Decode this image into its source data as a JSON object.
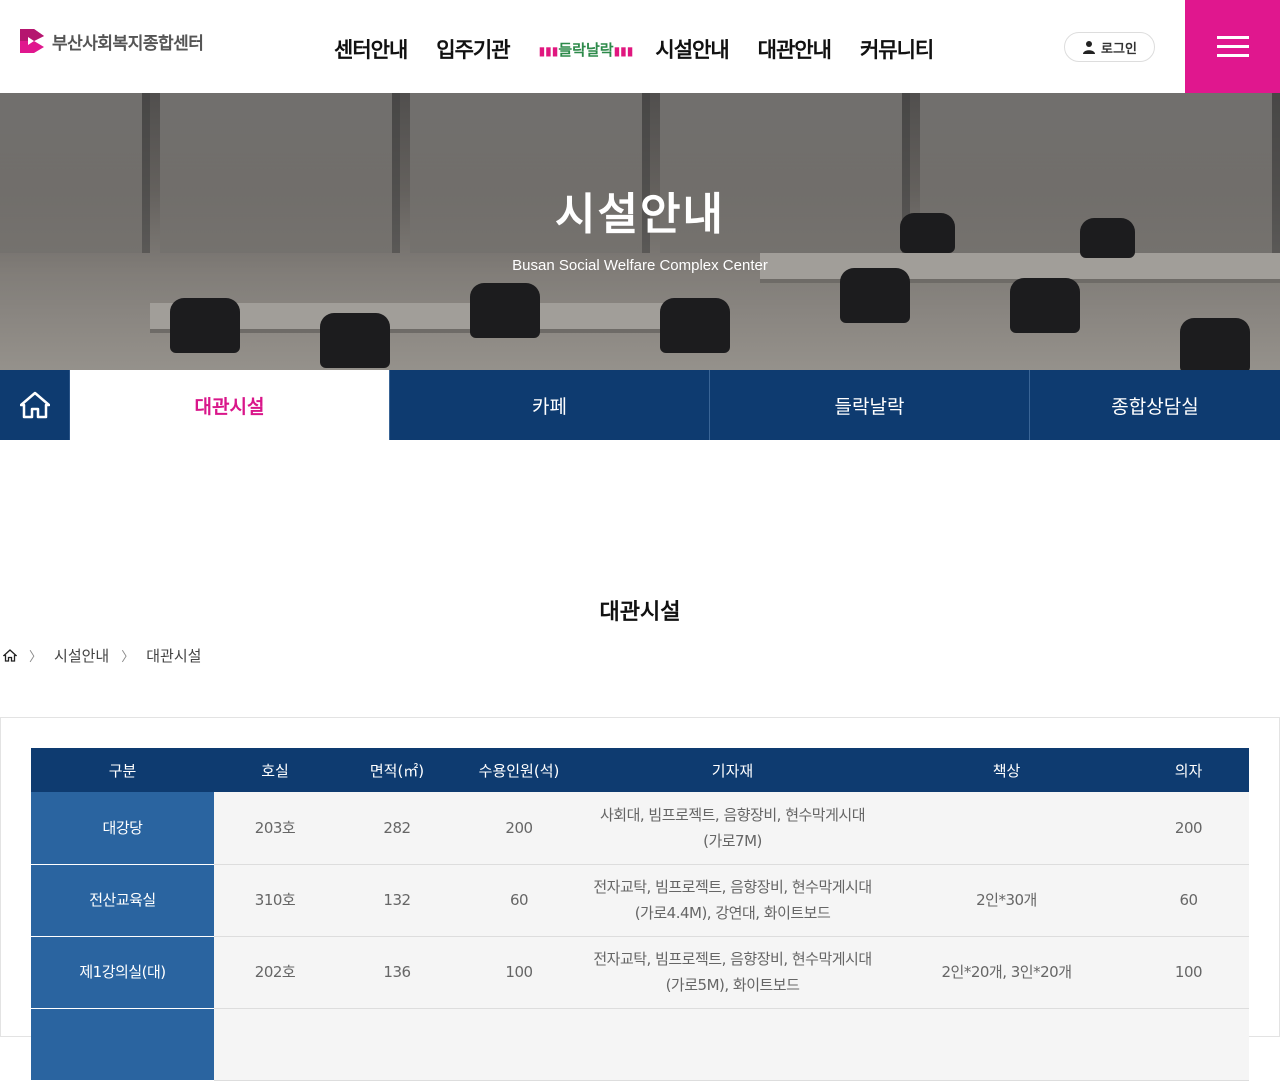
{
  "header": {
    "logo_text": "부산사회복지종합센터",
    "nav": [
      "센터안내",
      "입주기관",
      "시설안내",
      "대관안내",
      "커뮤니티"
    ],
    "brand_nav": "들락날락",
    "login_label": "로그인",
    "colors": {
      "accent": "#e0178e",
      "navy": "#0e3b70"
    }
  },
  "hero": {
    "title": "시설안내",
    "subtitle": "Busan Social Welfare Complex Center"
  },
  "tabs": [
    {
      "label": "대관시설",
      "active": true
    },
    {
      "label": "카페",
      "active": false
    },
    {
      "label": "들락날락",
      "active": false
    },
    {
      "label": "종합상담실",
      "active": false
    }
  ],
  "page": {
    "title": "대관시설",
    "breadcrumb": [
      "시설안내",
      "대관시설"
    ]
  },
  "table": {
    "headers": [
      "구분",
      "호실",
      "면적(㎡)",
      "수용인원(석)",
      "기자재",
      "책상",
      "의자"
    ],
    "rows": [
      {
        "name": "대강당",
        "room": "203호",
        "area": "282",
        "capacity": "200",
        "equip1": "사회대, 빔프로젝트, 음향장비, 현수막게시대",
        "equip2": "(가로7M)",
        "desk": "",
        "chair": "200"
      },
      {
        "name": "전산교육실",
        "room": "310호",
        "area": "132",
        "capacity": "60",
        "equip1": "전자교탁, 빔프로젝트, 음향장비, 현수막게시대",
        "equip2": "(가로4.4M), 강연대, 화이트보드",
        "desk": "2인*30개",
        "chair": "60"
      },
      {
        "name": "제1강의실(대)",
        "room": "202호",
        "area": "136",
        "capacity": "100",
        "equip1": "전자교탁, 빔프로젝트, 음향장비, 현수막게시대",
        "equip2": "(가로5M), 화이트보드",
        "desk": "2인*20개, 3인*20개",
        "chair": "100"
      }
    ]
  }
}
